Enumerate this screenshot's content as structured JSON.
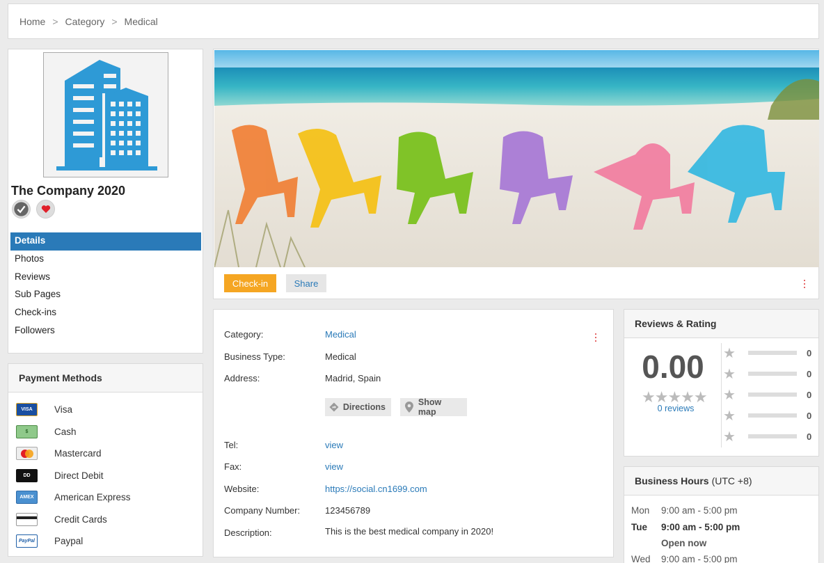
{
  "breadcrumb": [
    {
      "label": "Home"
    },
    {
      "label": "Category"
    },
    {
      "label": "Medical"
    }
  ],
  "breadcrumb_sep": ">",
  "profile": {
    "company_name": "The Company 2020",
    "verified_icon": "check-icon",
    "favorite_icon": "heart-icon",
    "nav": [
      {
        "label": "Details",
        "active": true
      },
      {
        "label": "Photos"
      },
      {
        "label": "Reviews"
      },
      {
        "label": "Sub Pages"
      },
      {
        "label": "Check-ins"
      },
      {
        "label": "Followers"
      }
    ]
  },
  "payment": {
    "title": "Payment Methods",
    "methods": [
      {
        "label": "Visa",
        "icon": "visa-card-icon"
      },
      {
        "label": "Cash",
        "icon": "cash-icon"
      },
      {
        "label": "Mastercard",
        "icon": "mastercard-icon"
      },
      {
        "label": "Direct Debit",
        "icon": "direct-debit-icon"
      },
      {
        "label": "American Express",
        "icon": "amex-icon"
      },
      {
        "label": "Credit Cards",
        "icon": "credit-card-icon"
      },
      {
        "label": "Paypal",
        "icon": "paypal-icon"
      }
    ]
  },
  "cover": {
    "checkin_label": "Check-in",
    "share_label": "Share"
  },
  "details": {
    "category_label": "Category:",
    "category_value": "Medical",
    "business_type_label": "Business Type:",
    "business_type_value": "Medical",
    "address_label": "Address:",
    "address_value": "Madrid, Spain",
    "directions_label": "Directions",
    "showmap_label": "Show map",
    "tel_label": "Tel:",
    "tel_value": "view",
    "fax_label": "Fax:",
    "fax_value": "view",
    "website_label": "Website:",
    "website_value": "https://social.cn1699.com",
    "company_number_label": "Company Number:",
    "company_number_value": "123456789",
    "description_label": "Description:",
    "description_value": "This is the best medical company in 2020!"
  },
  "reviews": {
    "title": "Reviews & Rating",
    "score": "0.00",
    "count_text": "0 reviews",
    "breakdown": [
      {
        "stars": 5,
        "count": "0"
      },
      {
        "stars": 4,
        "count": "0"
      },
      {
        "stars": 3,
        "count": "0"
      },
      {
        "stars": 2,
        "count": "0"
      },
      {
        "stars": 1,
        "count": "0"
      }
    ]
  },
  "hours": {
    "title": "Business Hours",
    "timezone": "(UTC +8)",
    "days": [
      {
        "day": "Mon",
        "time": "9:00 am - 5:00 pm"
      },
      {
        "day": "Tue",
        "time": "9:00 am - 5:00 pm",
        "today": true
      },
      {
        "day": "Wed",
        "time": "9:00 am - 5:00 pm"
      }
    ],
    "open_now": "Open now"
  },
  "colors": {
    "primary": "#2a7ab8",
    "checkin": "#f5a623",
    "kebab": "#d33333"
  }
}
